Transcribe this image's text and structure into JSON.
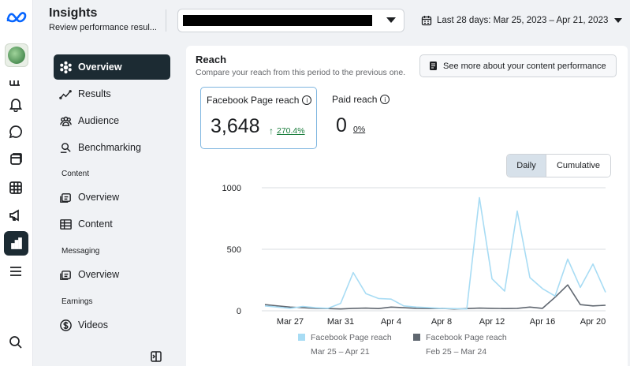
{
  "header": {
    "title": "Insights",
    "subtitle": "Review performance resul...",
    "date_range": "Last 28 days: Mar 25, 2023 – Apr 21, 2023"
  },
  "rail": {
    "icons": [
      "meta-logo-icon",
      "page-avatar",
      "grid-icon",
      "bell-icon",
      "chat-icon",
      "pages-icon",
      "table-icon",
      "megaphone-icon",
      "insights-bar-chart-icon",
      "menu-icon",
      "search-icon"
    ]
  },
  "sidenav": {
    "items": [
      {
        "label": "Overview",
        "icon": "overview-icon",
        "active": true
      },
      {
        "label": "Results",
        "icon": "results-icon"
      },
      {
        "label": "Audience",
        "icon": "audience-icon"
      },
      {
        "label": "Benchmarking",
        "icon": "benchmarking-icon"
      }
    ],
    "content_label": "Content",
    "content_items": [
      {
        "label": "Overview",
        "icon": "content-overview-icon"
      },
      {
        "label": "Content",
        "icon": "content-table-icon"
      }
    ],
    "messaging_label": "Messaging",
    "messaging_items": [
      {
        "label": "Overview",
        "icon": "messaging-overview-icon"
      }
    ],
    "earnings_label": "Earnings",
    "earnings_items": [
      {
        "label": "Videos",
        "icon": "dollar-icon"
      }
    ]
  },
  "reach": {
    "title": "Reach",
    "description": "Compare your reach from this period to the previous one.",
    "more_button": "See more about your content performance",
    "metrics": [
      {
        "label": "Facebook Page reach",
        "value": "3,648",
        "change": "270.4%",
        "direction": "up"
      },
      {
        "label": "Paid reach",
        "value": "0",
        "change": "0%",
        "direction": "flat"
      }
    ],
    "toggle": {
      "daily": "Daily",
      "cumulative": "Cumulative",
      "selected": "Daily"
    }
  },
  "colors": {
    "current_series": "#a8dcf4",
    "previous_series": "#606770",
    "active_nav": "#1c2b33",
    "positive": "#1a7d3c"
  },
  "chart_data": {
    "type": "line",
    "y_ticks": [
      "1000",
      "500",
      "0"
    ],
    "ylim": [
      0,
      1000
    ],
    "x_tick_labels": [
      "Mar 27",
      "Mar 31",
      "Apr 4",
      "Apr 8",
      "Apr 12",
      "Apr 16",
      "Apr 20"
    ],
    "x_tick_index": [
      2,
      6,
      10,
      14,
      18,
      22,
      26
    ],
    "series": [
      {
        "name": "Facebook Page reach",
        "range": "Mar 25 – Apr 21",
        "values": [
          40,
          30,
          20,
          35,
          25,
          20,
          60,
          310,
          140,
          100,
          95,
          40,
          30,
          25,
          20,
          18,
          15,
          920,
          260,
          160,
          810,
          270,
          180,
          120,
          420,
          190,
          380,
          150
        ]
      },
      {
        "name": "Facebook Page reach",
        "range": "Feb 25 – Mar 24",
        "values": [
          50,
          40,
          30,
          25,
          20,
          18,
          15,
          20,
          22,
          18,
          30,
          25,
          20,
          18,
          20,
          15,
          18,
          22,
          20,
          18,
          20,
          30,
          20,
          110,
          210,
          50,
          40,
          45
        ]
      }
    ]
  }
}
